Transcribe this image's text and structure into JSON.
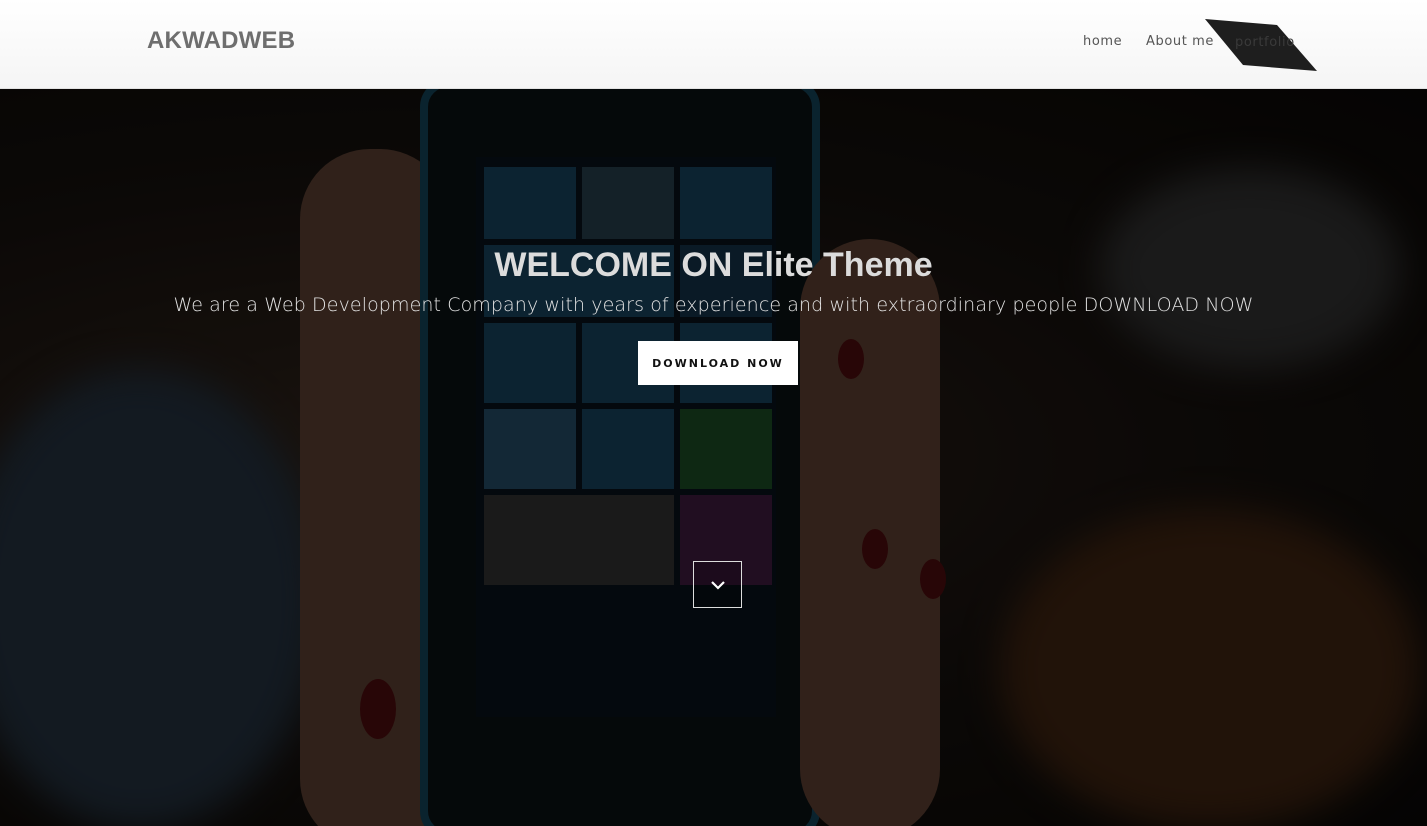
{
  "navbar": {
    "brand": "AKWADWEB",
    "items": [
      {
        "label": "home"
      },
      {
        "label": "About me"
      },
      {
        "label": "portfolio"
      }
    ]
  },
  "hero": {
    "title": "WELCOME ON Elite Theme",
    "subtitle": "We are a Web Development Company with years of experience and with extraordinary people DOWNLOAD NOW",
    "cta_label": "DOWNLOAD NOW",
    "scroll_icon": "chevron-down-icon"
  },
  "colors": {
    "brand_text": "#6e6e6e",
    "cta_bg": "#ffffff",
    "overlay": "rgba(0,0,0,0.55)"
  }
}
